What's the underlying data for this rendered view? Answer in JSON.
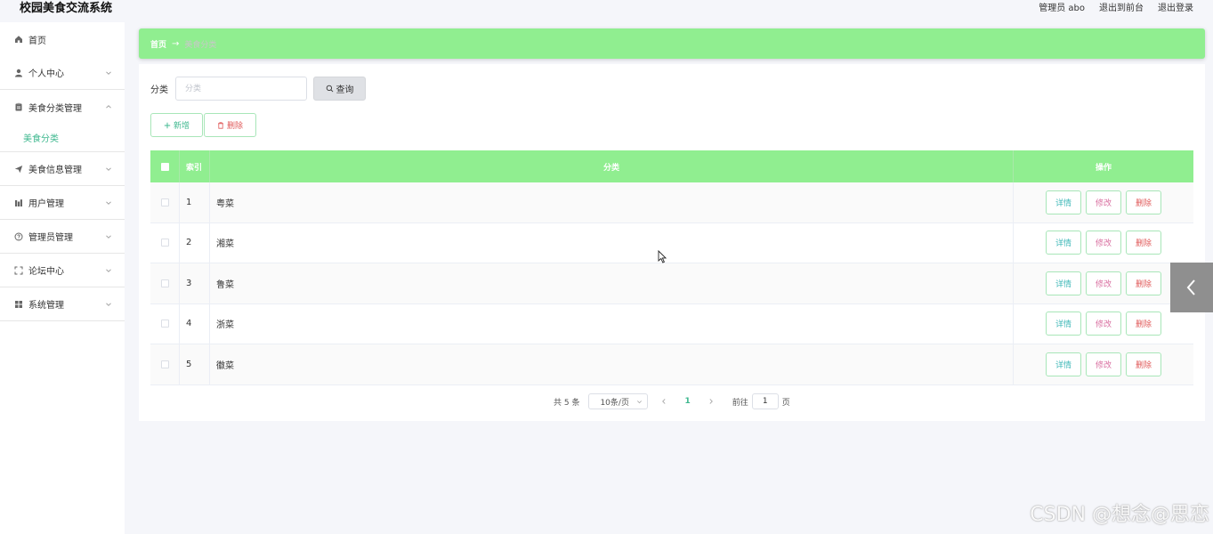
{
  "header": {
    "app_title": "校园美食交流系统",
    "admin_label": "管理员 abo",
    "exit_front": "退出到前台",
    "logout": "退出登录"
  },
  "sidebar": {
    "items": [
      {
        "label": "首页",
        "icon": "home-icon"
      },
      {
        "label": "个人中心",
        "icon": "user-icon"
      },
      {
        "label": "美食分类管理",
        "icon": "clipboard-icon"
      },
      {
        "label": "美食信息管理",
        "icon": "send-icon"
      },
      {
        "label": "用户管理",
        "icon": "chart-icon"
      },
      {
        "label": "管理员管理",
        "icon": "help-circle-icon"
      },
      {
        "label": "论坛中心",
        "icon": "expand-icon"
      },
      {
        "label": "系统管理",
        "icon": "grid-icon"
      }
    ],
    "sub_item": "美食分类"
  },
  "breadcrumb": {
    "home": "首页",
    "current": "美食分类"
  },
  "search": {
    "label": "分类",
    "placeholder": "分类",
    "value": "",
    "button": "查询"
  },
  "actions": {
    "add": "新增",
    "delete": "删除"
  },
  "table": {
    "headers": {
      "index": "索引",
      "category": "分类",
      "ops": "操作"
    },
    "rows": [
      {
        "index": "1",
        "category": "粤菜"
      },
      {
        "index": "2",
        "category": "湘菜"
      },
      {
        "index": "3",
        "category": "鲁菜"
      },
      {
        "index": "4",
        "category": "浙菜"
      },
      {
        "index": "5",
        "category": "徽菜"
      }
    ],
    "op_labels": {
      "detail": "详情",
      "edit": "修改",
      "delete": "删除"
    }
  },
  "pager": {
    "total": "共 5 条",
    "page_size": "10条/页",
    "current_page": "1",
    "goto_label": "前往",
    "goto_value": "1",
    "page_suffix": "页"
  },
  "watermark": "CSDN @想念@思恋",
  "colors": {
    "accent_green": "#90ee90",
    "link_green": "#3fb88f",
    "danger_red": "#e05a5a"
  }
}
